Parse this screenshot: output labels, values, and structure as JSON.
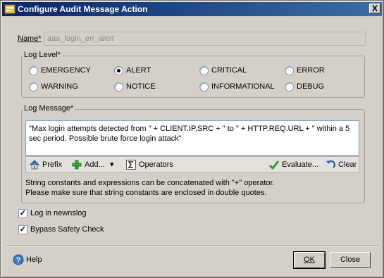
{
  "window": {
    "title": "Configure Audit Message Action",
    "close_label": "X"
  },
  "name": {
    "label": "Name*",
    "value": "aaa_login_err_alert"
  },
  "log_level": {
    "legend": "Log Level*",
    "options": [
      "EMERGENCY",
      "ALERT",
      "CRITICAL",
      "ERROR",
      "WARNING",
      "NOTICE",
      "INFORMATIONAL",
      "DEBUG"
    ],
    "selected": "ALERT"
  },
  "log_message": {
    "legend": "Log Message*",
    "value": "\"Max login attempts detected from \" + CLIENT.IP.SRC + \" to \" + HTTP.REQ.URL + \" within a 5 sec period. Possible brute force login attack\"",
    "toolbar": {
      "prefix": "Prefix",
      "add": "Add...",
      "add_arrow": "▾",
      "operators": "Operators",
      "evaluate": "Evaluate...",
      "clear": "Clear"
    },
    "hint_line1": "String constants and expressions can be concatenated with \"+\" operator.",
    "hint_line2": "Please make sure that string constants are enclosed in double quotes."
  },
  "options": {
    "log_in_newnslog": {
      "label": "Log in newnslog",
      "checked": true
    },
    "bypass_safety_check": {
      "label": "Bypass Safety Check",
      "checked": true
    }
  },
  "footer": {
    "help": "Help",
    "ok": "OK",
    "close": "Close"
  },
  "icons": {
    "prefix": "house-icon",
    "add": "plus-icon",
    "operators": "sigma-icon",
    "evaluate": "checkmark-icon",
    "clear": "undo-icon",
    "help": "help-icon"
  },
  "colors": {
    "titlebar_start": "#0a246a",
    "titlebar_end": "#3a6ea5",
    "dialog_bg": "#d4d0c8"
  }
}
